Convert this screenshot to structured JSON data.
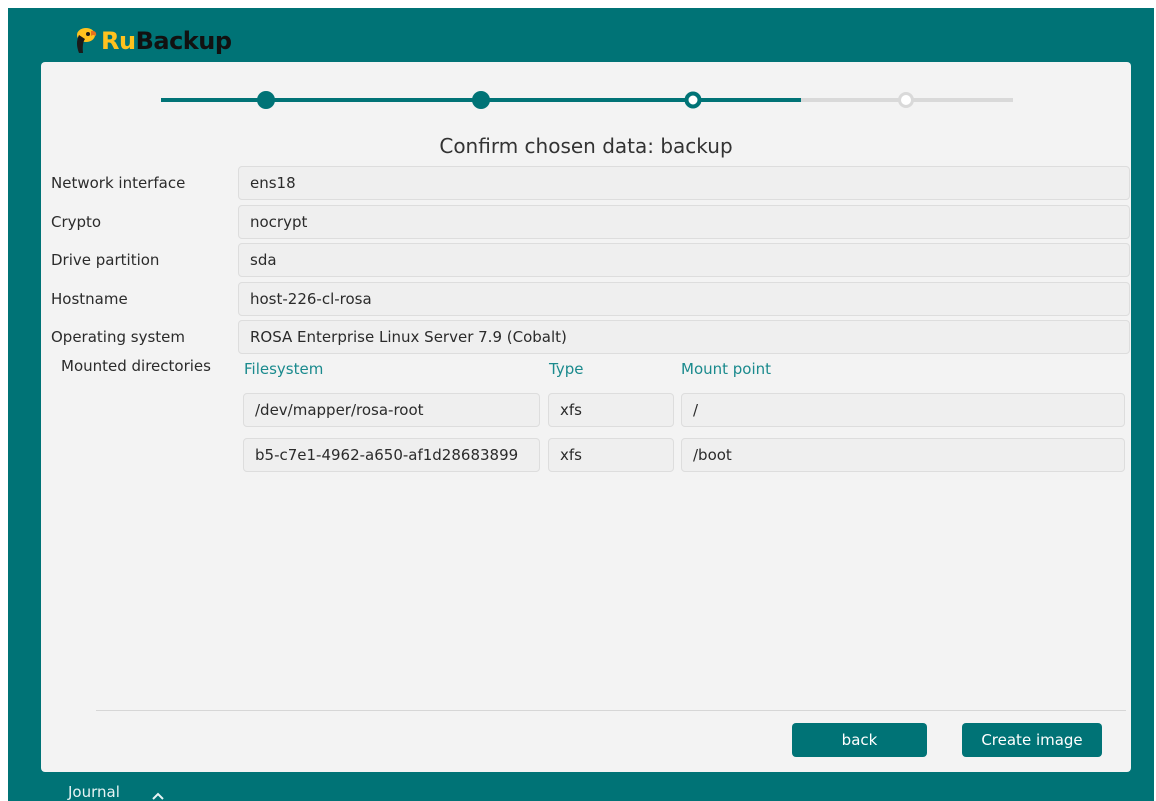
{
  "header": {
    "brand_ru": "Ru",
    "brand_rest": "Backup"
  },
  "wizard": {
    "steps_total": 4,
    "current_step": 3,
    "title": "Confirm chosen data: backup"
  },
  "fields": [
    {
      "label": "Network interface",
      "value": "ens18"
    },
    {
      "label": "Crypto",
      "value": "nocrypt"
    },
    {
      "label": "Drive partition",
      "value": "sda"
    },
    {
      "label": "Hostname",
      "value": "host-226-cl-rosa"
    },
    {
      "label": "Operating system",
      "value": "ROSA Enterprise Linux Server 7.9 (Cobalt)"
    }
  ],
  "mounts": {
    "label": "Mounted directories",
    "headers": {
      "filesystem": "Filesystem",
      "type": "Type",
      "mount_point": "Mount point"
    },
    "rows": [
      {
        "filesystem": "/dev/mapper/rosa-root",
        "type": "xfs",
        "mount_point": "/"
      },
      {
        "filesystem": "b5-c7e1-4962-a650-af1d28683899",
        "type": "xfs",
        "mount_point": "/boot"
      }
    ]
  },
  "buttons": {
    "back": "back",
    "create": "Create image"
  },
  "footer": {
    "journal": "Journal"
  },
  "colors": {
    "teal": "#007376",
    "accent_text": "#1a8a8d",
    "logo_yellow": "#ffc21e",
    "inactive": "#d9d9d9"
  },
  "icons": {
    "logo": "toucan-logo-icon",
    "journal_toggle": "chevron-up-icon"
  }
}
